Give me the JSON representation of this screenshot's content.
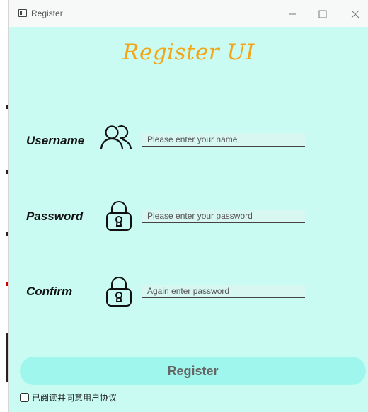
{
  "window": {
    "title": "Register"
  },
  "heading": "Register UI",
  "form": {
    "username": {
      "label": "Username",
      "placeholder": "Please enter your name",
      "icon": "users-icon"
    },
    "password": {
      "label": "Password",
      "placeholder": "Please enter your password",
      "icon": "lock-icon"
    },
    "confirm": {
      "label": "Confirm",
      "placeholder": "Again enter password",
      "icon": "lock-icon"
    }
  },
  "register_button": "Register",
  "agreement": {
    "label": "已阅读并同意用户协议",
    "checked": false
  },
  "colors": {
    "background": "#c9fbf3",
    "heading": "#f2a516",
    "button": "#9ff6ec"
  }
}
